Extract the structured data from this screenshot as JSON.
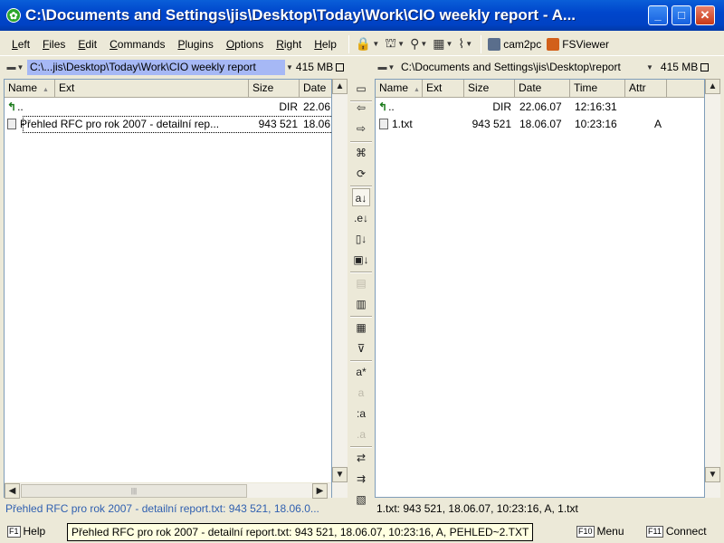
{
  "window": {
    "title": "C:\\Documents and Settings\\jis\\Desktop\\Today\\Work\\CIO weekly report - A...",
    "minimize": "_",
    "maximize": "□",
    "close": "✕"
  },
  "menu": [
    "Left",
    "Files",
    "Edit",
    "Commands",
    "Plugins",
    "Options",
    "Right",
    "Help"
  ],
  "toolbar": {
    "plugins": [
      {
        "label": "cam2pc",
        "color": "#5A6E8C"
      },
      {
        "label": "FSViewer",
        "color": "#D2601A"
      }
    ]
  },
  "left_panel": {
    "path": "C:\\...jis\\Desktop\\Today\\Work\\CIO weekly report",
    "free_space": "415 MB",
    "columns": [
      "Name",
      "Ext",
      "Size",
      "Date"
    ],
    "rows": [
      {
        "name": "..",
        "ext": "",
        "size": "DIR",
        "date": "22.06."
      },
      {
        "name": "Přehled RFC pro rok 2007 - detailní rep...",
        "ext": "",
        "size": "943 521",
        "date": "18.06."
      }
    ],
    "status": "Přehled RFC pro rok 2007 - detailní report.txt: 943 521, 18.06.0..."
  },
  "right_panel": {
    "path": "C:\\Documents and Settings\\jis\\Desktop\\report",
    "free_space": "415 MB",
    "columns": [
      "Name",
      "Ext",
      "Size",
      "Date",
      "Time",
      "Attr"
    ],
    "rows": [
      {
        "name": "..",
        "ext": "",
        "size": "DIR",
        "date": "22.06.07",
        "time": "12:16:31",
        "attr": ""
      },
      {
        "name": "1.txt",
        "ext": "",
        "size": "943 521",
        "date": "18.06.07",
        "time": "10:23:16",
        "attr": "A"
      }
    ],
    "status": "1.txt: 943 521, 18.06.07, 10:23:16, A, 1.txt"
  },
  "function_keys": [
    {
      "key": "F1",
      "label": "Help"
    },
    {
      "key": "F10",
      "label": "Menu"
    },
    {
      "key": "F11",
      "label": "Connect"
    }
  ],
  "tooltip": "Přehled RFC pro rok 2007 - detailní report.txt: 943 521, 18.06.07, 10:23:16, A, PEHLED~2.TXT"
}
